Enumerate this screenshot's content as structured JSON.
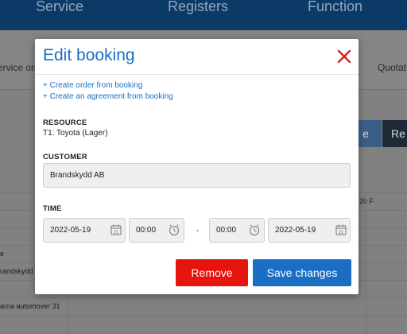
{
  "background": {
    "nav": [
      "Service",
      "Registers",
      "Function"
    ],
    "subnav": [
      "ervice ord",
      "Quotat"
    ],
    "buttons": [
      "e",
      "Re"
    ],
    "row_texts": [
      "20 F",
      "e",
      "randskydd",
      "arna automover 31"
    ]
  },
  "modal": {
    "title": "Edit booking",
    "links": {
      "create_order": "+ Create order from booking",
      "create_agreement": "+ Create an agreement from booking"
    },
    "resource": {
      "label": "RESOURCE",
      "value": "T1: Toyota (Lager)"
    },
    "customer": {
      "label": "CUSTOMER",
      "value": "Brandskydd AB"
    },
    "time": {
      "label": "TIME",
      "start_date": "2022-05-19",
      "start_time": "00:00",
      "separator": "-",
      "end_time": "00:00",
      "end_date": "2022-05-19",
      "calendar_day": "21"
    },
    "buttons": {
      "remove": "Remove",
      "save": "Save changes"
    },
    "colors": {
      "accent": "#1a6fc4",
      "danger": "#e5140c"
    }
  }
}
